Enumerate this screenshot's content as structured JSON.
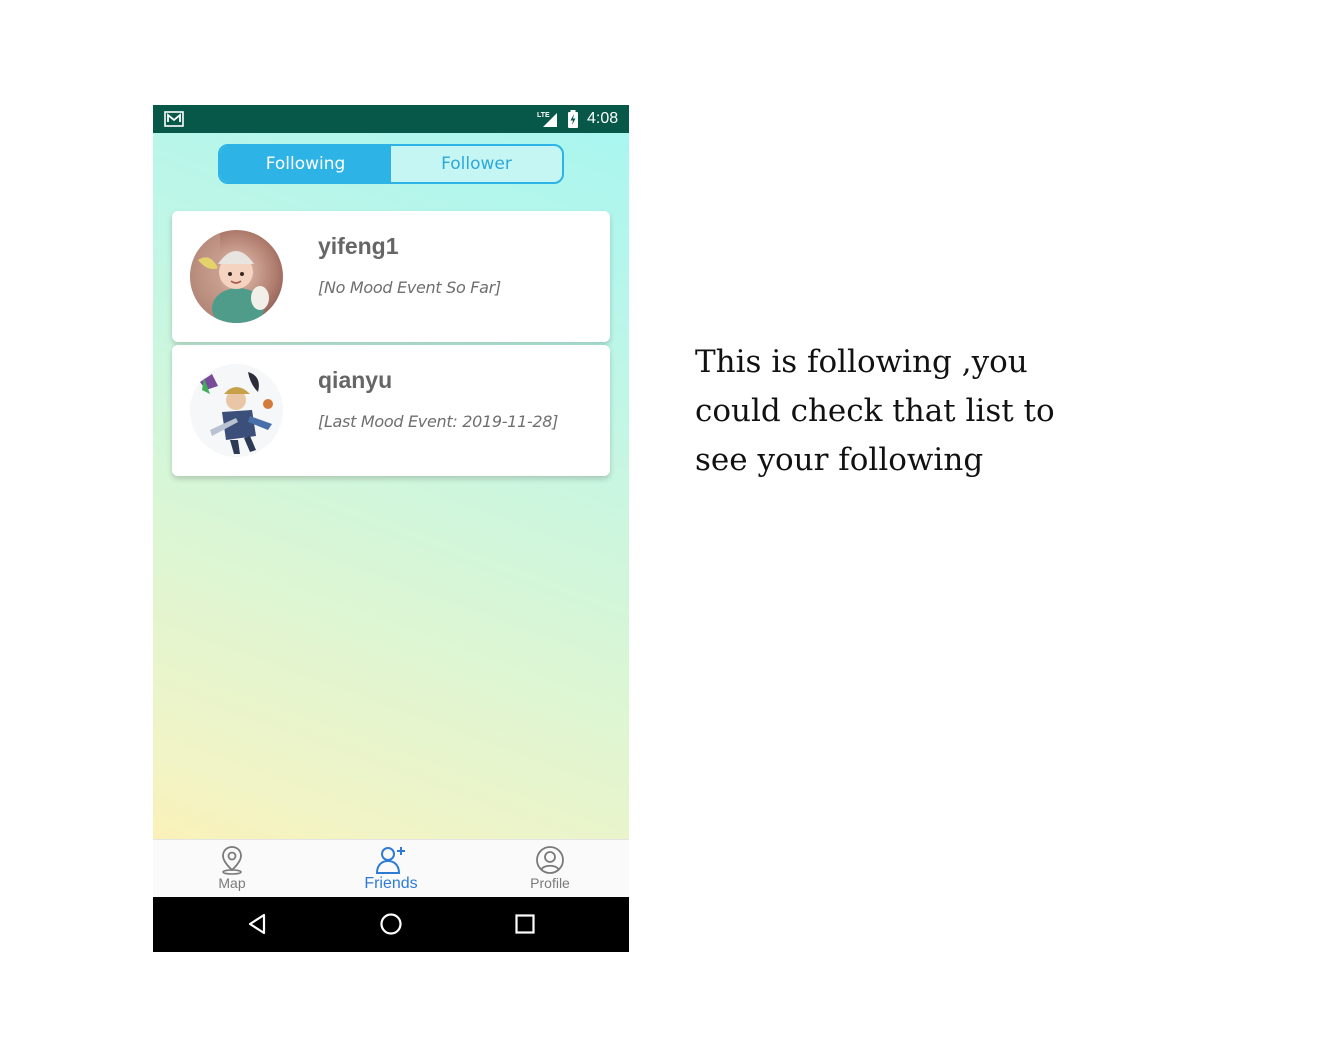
{
  "status_bar": {
    "time": "4:08",
    "network": "LTE",
    "icons": [
      "mail-icon",
      "lte-signal-icon",
      "battery-charging-icon"
    ]
  },
  "tabs": [
    {
      "label": "Following",
      "active": true
    },
    {
      "label": "Follower",
      "active": false
    }
  ],
  "friends": [
    {
      "name": "yifeng1",
      "status": "[No Mood Event So Far]"
    },
    {
      "name": "qianyu",
      "status": "[Last Mood Event: 2019-11-28]"
    }
  ],
  "bottom_nav": [
    {
      "label": "Map",
      "icon": "map-pin-icon",
      "active": false
    },
    {
      "label": "Friends",
      "icon": "add-friend-icon",
      "active": true
    },
    {
      "label": "Profile",
      "icon": "profile-icon",
      "active": false
    }
  ],
  "system_nav": [
    "back-icon",
    "home-icon",
    "recents-icon"
  ],
  "caption": "This is following ,you could check that list to see your following",
  "colors": {
    "status_bar": "#075849",
    "accent": "#2eb3e6",
    "nav_active": "#2d7bd4"
  }
}
